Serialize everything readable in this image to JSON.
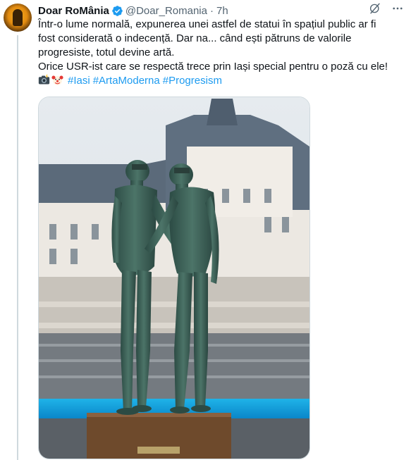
{
  "author": {
    "name": "Doar RoMânia",
    "handle": "@Doar_Romania",
    "separator": "·",
    "time": "7h",
    "verified_icon": "verified-badge-icon",
    "avatar_icon": "avatar"
  },
  "header_icons": [
    "grok-icon",
    "more-icon"
  ],
  "tweet": {
    "line1": "Într-o lume normală, expunerea unei astfel de statui în spațiul public ar fi",
    "line2": "fost considerată o indecență. Dar na... când ești pătruns de valorile",
    "line3": "progresiste, totul devine artă.",
    "line4": "Orice USR-ist care se respectă trece prin Iași special pentru o poză cu ele!",
    "emojis": [
      "camera-with-flash-icon",
      "clown-face-icon"
    ],
    "hashtags": [
      "#Iasi",
      "#ArtaModerna",
      "#Progresism"
    ]
  },
  "media": {
    "type": "photo",
    "subject": "statue-photo"
  },
  "colors": {
    "text": "#0f1419",
    "secondary": "#536471",
    "link": "#1d9bf0",
    "verified": "#1d9bf0",
    "border": "#cfd9de"
  }
}
